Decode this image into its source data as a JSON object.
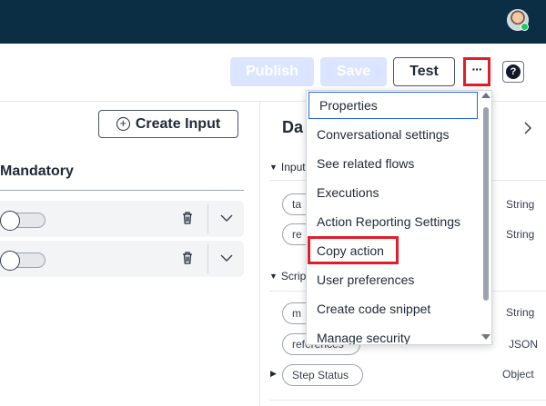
{
  "toolbar": {
    "publish_label": "Publish",
    "save_label": "Save",
    "test_label": "Test",
    "more_label": "···",
    "help_label": "?"
  },
  "left_panel": {
    "create_input_label": "Create Input",
    "mandatory_label": "Mandatory"
  },
  "right_panel": {
    "title": "Da",
    "input_section_label": "Input",
    "script_section_label": "Scrip",
    "pills": [
      "ta",
      "re",
      "m",
      "references",
      "Step Status"
    ],
    "types": [
      "String",
      "String",
      "String",
      "JSON",
      "Object"
    ]
  },
  "menu": {
    "items": [
      "Properties",
      "Conversational settings",
      "See related flows",
      "Executions",
      "Action Reporting Settings",
      "Copy action",
      "User preferences",
      "Create code snippet",
      "Manage security"
    ]
  },
  "colors": {
    "topbar": "#0b2e45",
    "highlight_red": "#e11d2b",
    "disabled_button": "#dbe5ff",
    "focus_blue": "#2563eb"
  },
  "icons": [
    "plus-circle-icon",
    "trash-icon",
    "chevron-down-icon",
    "chevron-right-icon",
    "help-icon",
    "more-icon",
    "avatar-icon"
  ]
}
